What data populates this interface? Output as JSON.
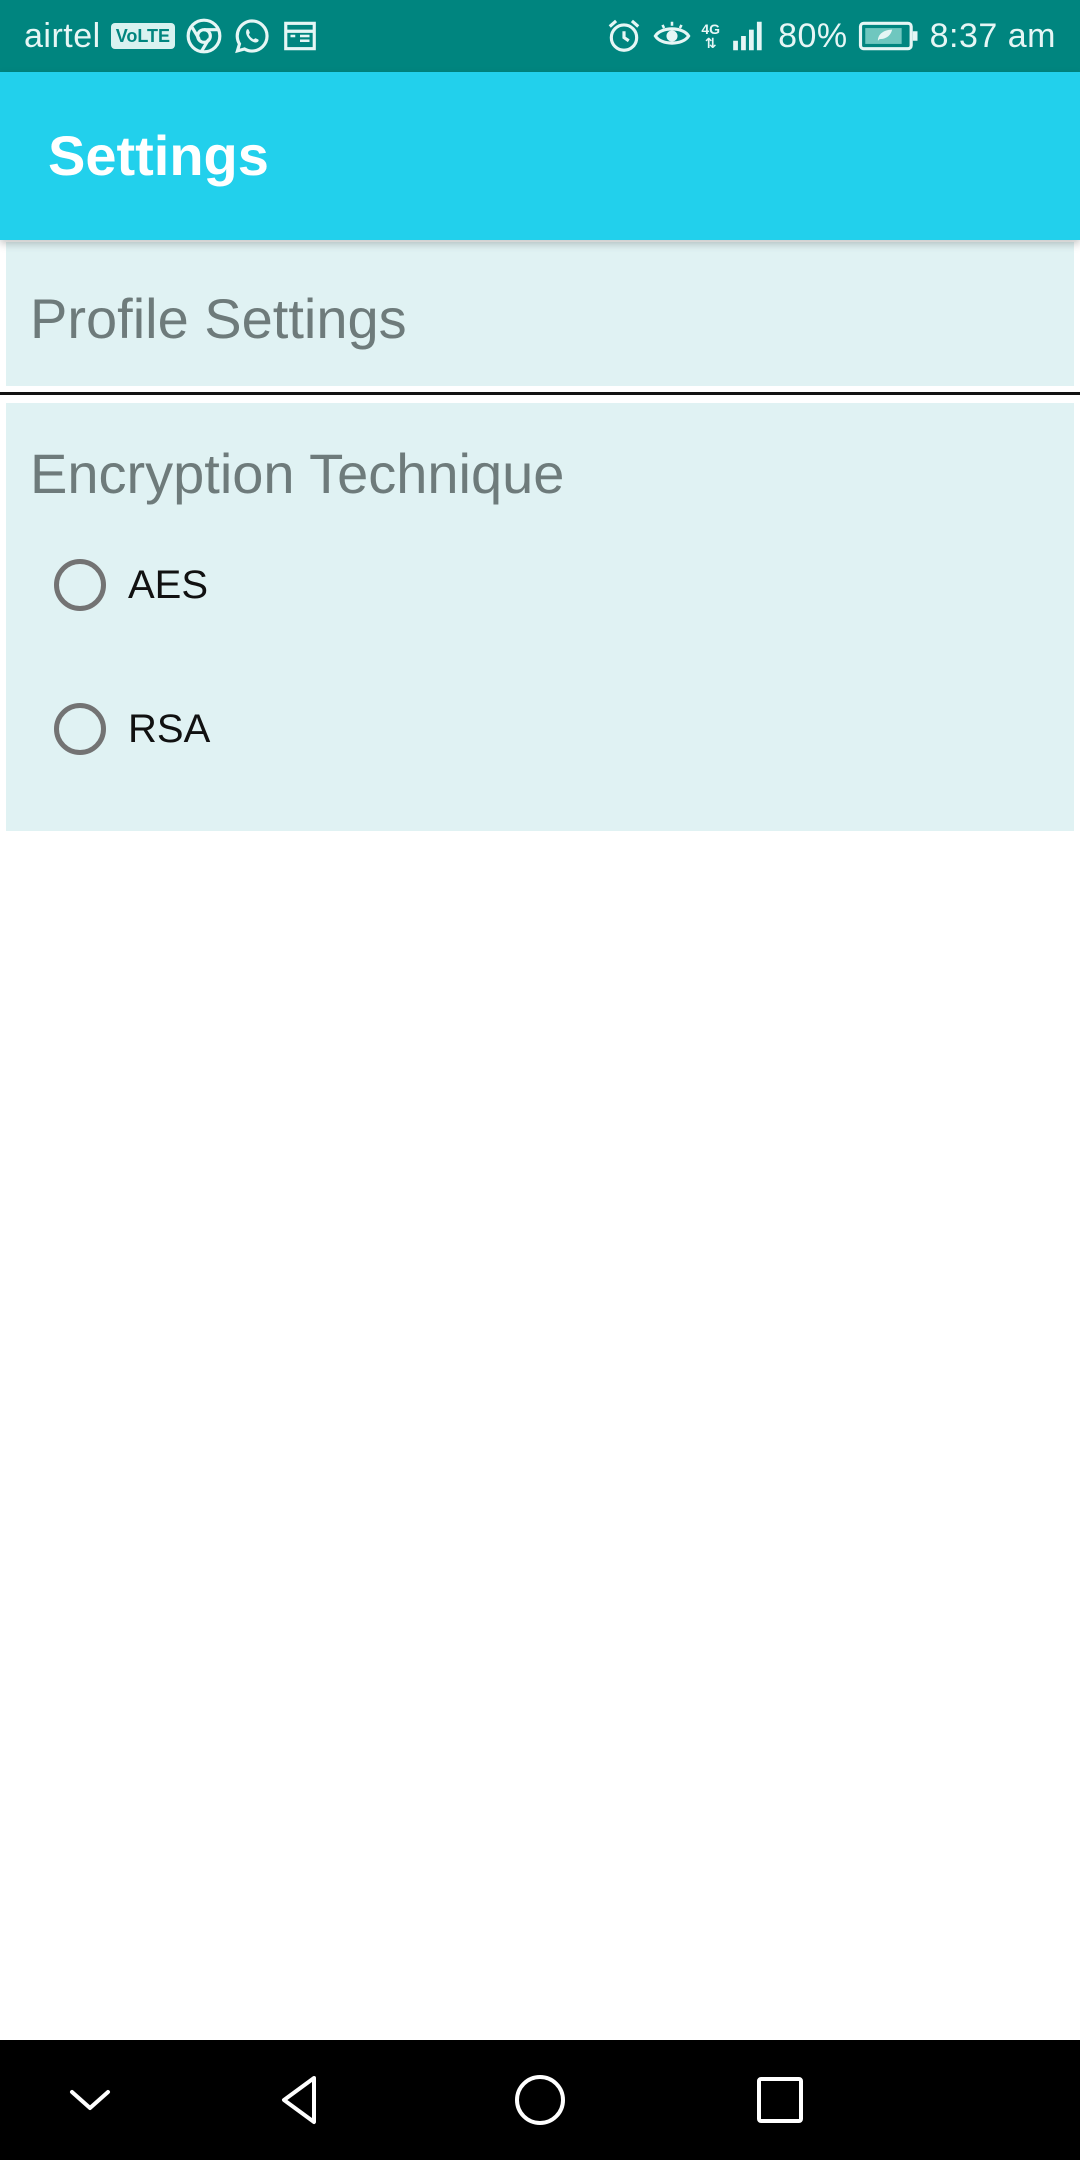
{
  "status_bar": {
    "carrier": "airtel",
    "volte_label": "VoLTE",
    "network_label": "4G",
    "battery_percent": "80%",
    "time": "8:37 am",
    "icons": [
      "chrome-icon",
      "whatsapp-icon",
      "calendar-icon",
      "alarm-icon",
      "eye-comfort-icon",
      "signal-icon",
      "battery-icon"
    ]
  },
  "app_bar": {
    "title": "Settings",
    "color": "#22d0ec"
  },
  "profile_section": {
    "title": "Profile Settings"
  },
  "encryption_section": {
    "title": "Encryption Technique",
    "options": [
      {
        "label": "AES",
        "selected": false
      },
      {
        "label": "RSA",
        "selected": false
      }
    ]
  },
  "nav_bar": {
    "buttons": [
      "collapse-icon",
      "back-icon",
      "home-icon",
      "recents-icon"
    ]
  },
  "colors": {
    "status_bar": "#00857f",
    "card_background": "#e0f2f3",
    "section_title": "#6e7b7b",
    "radio_outline": "#737373"
  }
}
